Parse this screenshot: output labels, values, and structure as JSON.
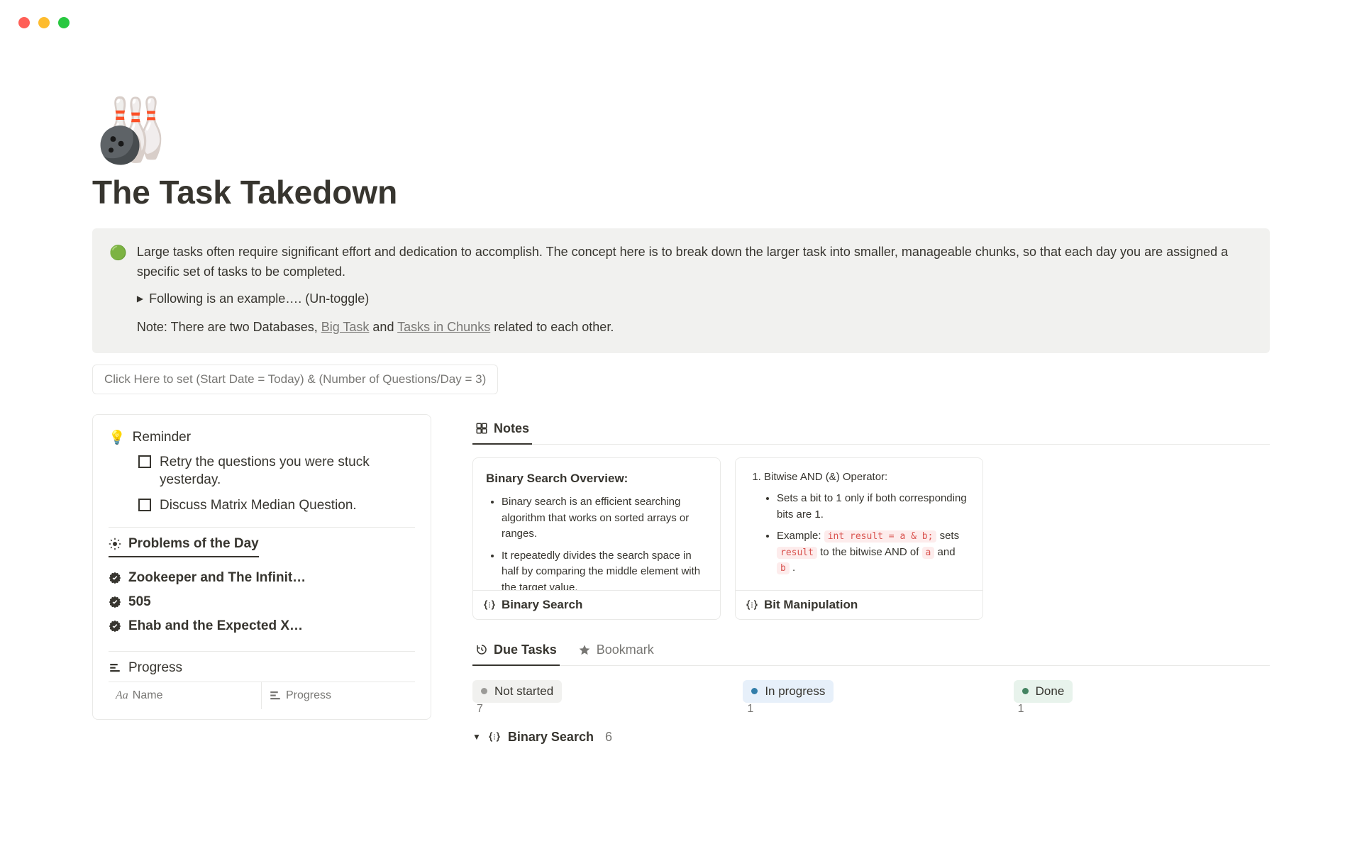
{
  "page": {
    "icon": "🎳",
    "title": "The Task Takedown"
  },
  "callout": {
    "icon": "🟢",
    "text": "Large tasks often require significant effort and dedication to accomplish. The concept here is to break down the larger task into smaller, manageable chunks, so that each day you are assigned a specific set of tasks to be completed.",
    "toggle_label": "Following is an example…. (Un-toggle)",
    "note_prefix": "Note: There are two Databases, ",
    "note_link1": "Big Task",
    "note_mid": " and ",
    "note_link2": "Tasks in Chunks",
    "note_suffix": " related to each other."
  },
  "meta_button": "Click Here to set (Start Date = Today) & (Number of Questions/Day = 3)",
  "left": {
    "reminder_icon": "💡",
    "reminder_title": "Reminder",
    "reminders": [
      "Retry the questions you were stuck yesterday.",
      "Discuss Matrix Median Question."
    ],
    "problems_icon": "sun",
    "problems_title": "Problems of the Day",
    "problems": [
      "Zookeeper and The Infinit…",
      "505",
      "Ehab and the Expected X…"
    ],
    "progress_icon": "bars",
    "progress_title": "Progress",
    "th_name": "Name",
    "th_progress": "Progress"
  },
  "right": {
    "tab_notes": "Notes",
    "notes": [
      {
        "title": "Binary Search Overview:",
        "bullets": [
          "Binary search is an efficient searching algorithm that works on sorted arrays or ranges.",
          "It repeatedly divides the search space in half by comparing the middle element with the target value."
        ],
        "footer": "Binary Search"
      },
      {
        "ol_label": "Bitwise AND (&) Operator:",
        "bullets": [
          {
            "text": "Sets a bit to 1 only if both corresponding bits are 1."
          },
          {
            "html": true,
            "prefix": "Example: ",
            "code1": "int result = a & b;",
            "mid1": " sets ",
            "code2": "result",
            "mid2": " to the bitwise AND of ",
            "code3": "a",
            "mid3": " and ",
            "code4": "b",
            "suffix": " ."
          }
        ],
        "footer": "Bit Manipulation"
      }
    ],
    "tab_due": "Due Tasks",
    "tab_bookmark": "Bookmark",
    "kanban": [
      {
        "label": "Not started",
        "count": "7",
        "style": "notstarted",
        "dot": "grey"
      },
      {
        "label": "In progress",
        "count": "1",
        "style": "inprogress",
        "dot": "blue"
      },
      {
        "label": "Done",
        "count": "1",
        "style": "done",
        "dot": "green"
      }
    ],
    "group_label": "Binary Search",
    "group_count": "6"
  }
}
